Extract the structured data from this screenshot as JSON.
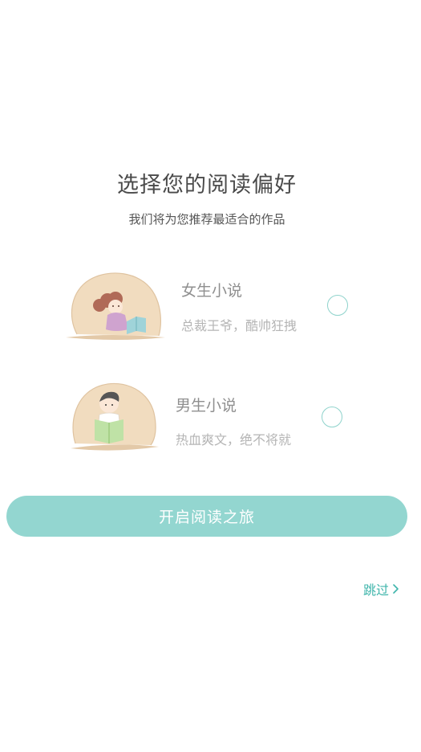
{
  "header": {
    "title": "选择您的阅读偏好",
    "subtitle": "我们将为您推荐最适合的作品"
  },
  "options": [
    {
      "title": "女生小说",
      "description": "总裁王爷，酷帅狂拽",
      "selected": false,
      "icon": "girl-reading-illustration"
    },
    {
      "title": "男生小说",
      "description": "热血爽文，绝不将就",
      "selected": false,
      "icon": "boy-reading-illustration"
    }
  ],
  "actions": {
    "start_label": "开启阅读之旅",
    "skip_label": "跳过"
  },
  "colors": {
    "accent": "#93d6d0",
    "accent_dark": "#3fb5ab",
    "title_text": "#4a4a4a",
    "illustration_bg": "#f1dcbf"
  }
}
